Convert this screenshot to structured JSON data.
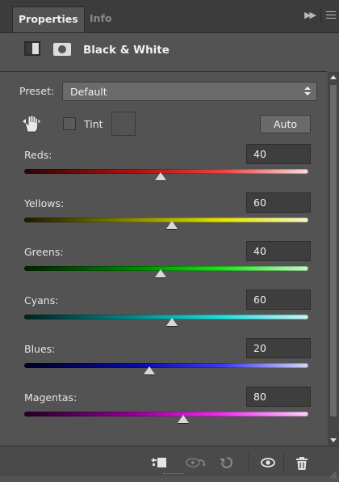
{
  "tabs": [
    {
      "label": "Properties",
      "active": true
    },
    {
      "label": "Info",
      "active": false
    }
  ],
  "header": {
    "title": "Black & White",
    "icons": [
      "adjustment-layer-icon",
      "layer-mask-icon"
    ]
  },
  "preset": {
    "label": "Preset:",
    "value": "Default"
  },
  "tint": {
    "label": "Tint",
    "checked": false
  },
  "auto_label": "Auto",
  "sliders": [
    {
      "label": "Reds:",
      "value": "40",
      "gradient": [
        "#2e0606",
        "#b80f0f",
        "#ef4141",
        "#f6dddd"
      ]
    },
    {
      "label": "Yellows:",
      "value": "60",
      "gradient": [
        "#1b1b00",
        "#8f8f00",
        "#e4e400",
        "#f7f7c8"
      ]
    },
    {
      "label": "Greens:",
      "value": "40",
      "gradient": [
        "#002200",
        "#008a00",
        "#25e025",
        "#c8f7c8"
      ]
    },
    {
      "label": "Cyans:",
      "value": "60",
      "gradient": [
        "#002222",
        "#008f8f",
        "#20e0e0",
        "#c8f7f7"
      ]
    },
    {
      "label": "Blues:",
      "value": "20",
      "gradient": [
        "#00001f",
        "#0a0aa8",
        "#3c3cf0",
        "#d6d6f7"
      ]
    },
    {
      "label": "Magentas:",
      "value": "80",
      "gradient": [
        "#220022",
        "#9a009a",
        "#f030f0",
        "#f7d6f7"
      ]
    }
  ],
  "slider_range": {
    "min": -200,
    "max": 300
  },
  "footer_icons": [
    "clip-to-layer-icon",
    "view-previous-state-icon",
    "reset-icon",
    "visibility-eye-icon",
    "trash-icon"
  ]
}
